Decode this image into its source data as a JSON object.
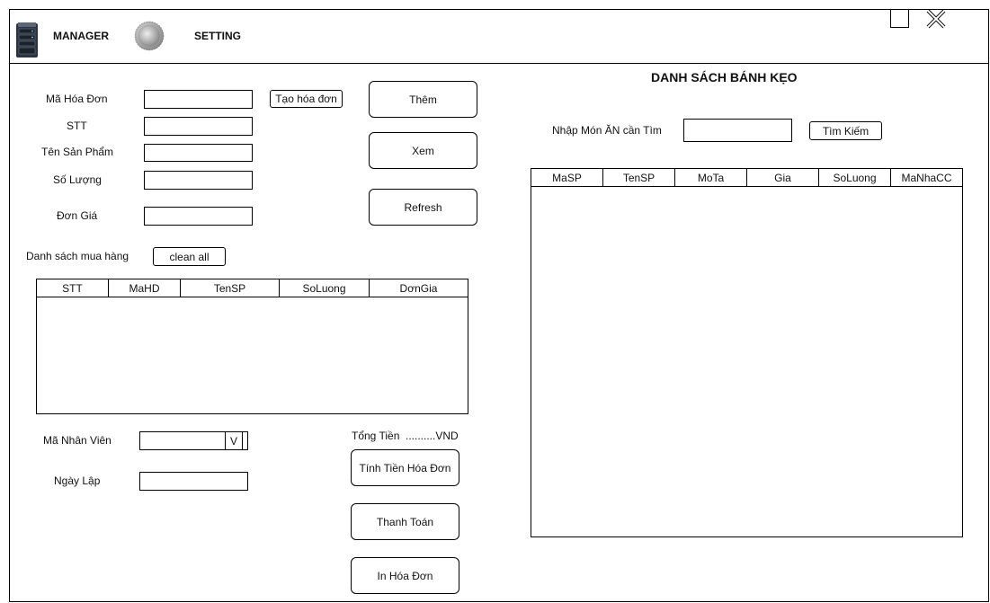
{
  "nav": {
    "manager_label": "MANAGER",
    "setting_label": "SETTING",
    "close_glyph": "X"
  },
  "form": {
    "ma_hoa_don_label": "Mã Hóa Đơn",
    "stt_label": "STT",
    "ten_san_pham_label": "Tên Sản Phẩm",
    "so_luong_label": "Số Lượng",
    "don_gia_label": "Đơn Giá",
    "tao_hoa_don_label": "Tạo hóa đơn"
  },
  "actions": {
    "them": "Thêm",
    "xem": "Xem",
    "refresh": "Refresh"
  },
  "cart": {
    "title": "Danh sách mua hàng",
    "clean_label": "clean all",
    "columns": [
      "STT",
      "MaHD",
      "TenSP",
      "SoLuong",
      "DơnGia"
    ]
  },
  "footer": {
    "ma_nhan_vien_label": "Mã Nhân Viên",
    "dropdown_glyph": "V",
    "ngay_lap_label": "Ngày Lập",
    "tong_tien_label": "Tổng Tiền",
    "tong_tien_value": "..........VND",
    "tinh_tien_label": "Tính Tiền Hóa Đơn",
    "thanh_toan_label": "Thanh Toán",
    "in_hoa_don_label": "In Hóa Đơn"
  },
  "catalog": {
    "title": "DANH SÁCH BÁNH KẸO",
    "search_label": "Nhập Món ĂN cần Tìm",
    "search_button": "Tìm Kiếm",
    "columns": [
      "MaSP",
      "TenSP",
      "MoTa",
      "Gia",
      "SoLuong",
      "MaNhaCC"
    ]
  }
}
